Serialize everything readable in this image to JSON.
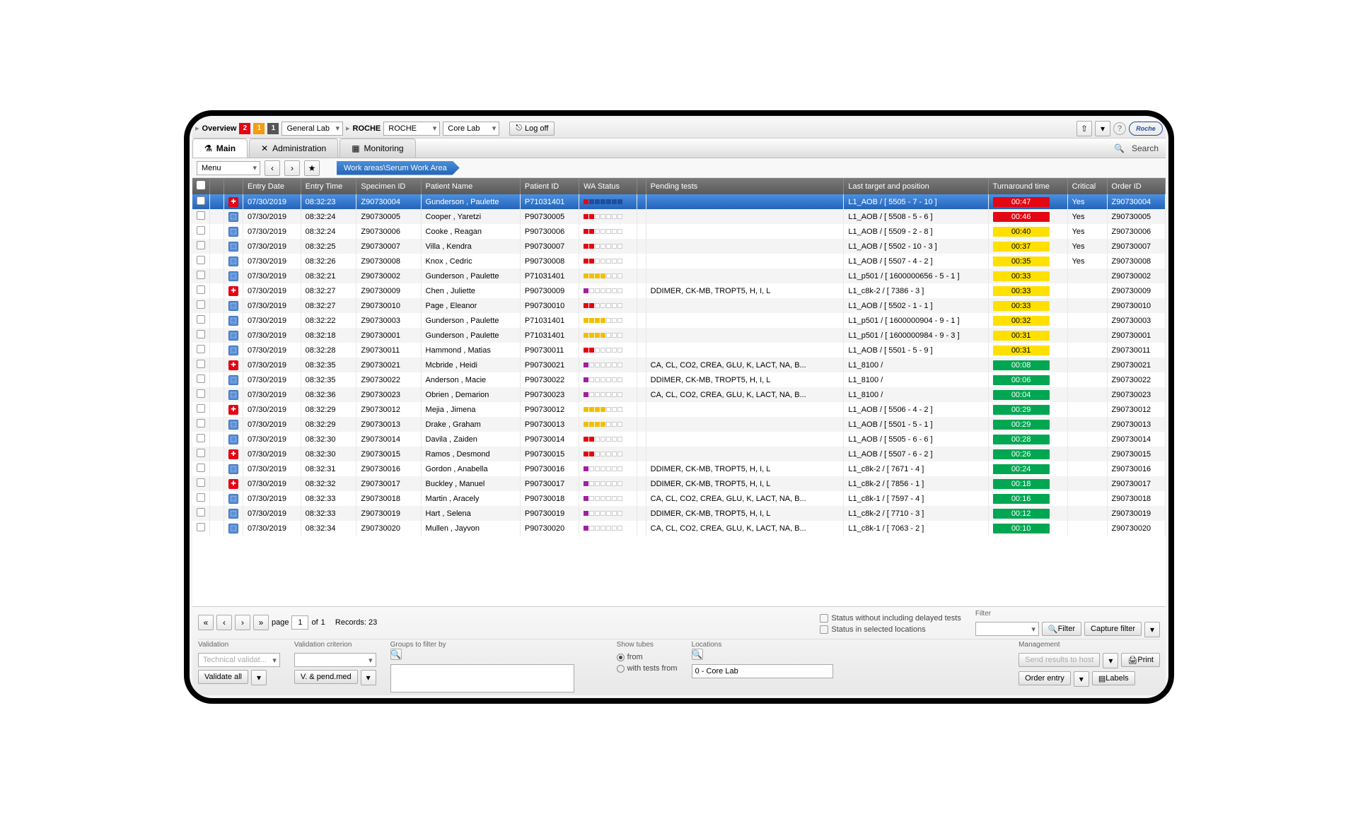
{
  "top": {
    "overview": "Overview",
    "badges": [
      "2",
      "1",
      "1"
    ],
    "lab_sel": "General Lab",
    "nav_arrow": "▸",
    "roche_label": "ROCHE",
    "roche_sel": "ROCHE",
    "corelab_sel": "Core Lab",
    "logoff": "Log off",
    "logo_text": "Roche"
  },
  "tabs": {
    "main": "Main",
    "admin": "Administration",
    "monitoring": "Monitoring",
    "search": "Search"
  },
  "toolbar": {
    "menu": "Menu",
    "prev": "‹",
    "next": "›",
    "star": "★",
    "breadcrumb": "Work areas\\Serum Work Area"
  },
  "cols": {
    "c0": "",
    "c1": "",
    "c2": "",
    "entry_date": "Entry Date",
    "entry_time": "Entry Time",
    "specimen": "Specimen ID",
    "patient": "Patient Name",
    "patient_id": "Patient ID",
    "wa": "WA Status",
    "pending": "Pending tests",
    "target": "Last target and position",
    "tat": "Turnaround time",
    "critical": "Critical",
    "order": "Order ID"
  },
  "rows": [
    {
      "sel": true,
      "icon": "red",
      "date": "07/30/2019",
      "time": "08:32:23",
      "spec": "Z90730004",
      "pat": "Gunderson , Paulette",
      "pid": "P71031401",
      "wa": "rbbbbbb",
      "pend": "",
      "tgt": "L1_AOB / [ 5505 - 7 - 10 ]",
      "tat": "00:47",
      "tcolor": "red",
      "crit": "Yes",
      "ord": "Z90730004"
    },
    {
      "icon": "blue",
      "date": "07/30/2019",
      "time": "08:32:24",
      "spec": "Z90730005",
      "pat": "Cooper , Yaretzi",
      "pid": "P90730005",
      "wa": "rr.....",
      "pend": "",
      "tgt": "L1_AOB / [ 5508 - 5 - 6 ]",
      "tat": "00:46",
      "tcolor": "red",
      "crit": "Yes",
      "ord": "Z90730005"
    },
    {
      "icon": "blue",
      "date": "07/30/2019",
      "time": "08:32:24",
      "spec": "Z90730006",
      "pat": "Cooke , Reagan",
      "pid": "P90730006",
      "wa": "rr.....",
      "pend": "",
      "tgt": "L1_AOB / [ 5509 - 2 - 8 ]",
      "tat": "00:40",
      "tcolor": "yellow",
      "crit": "Yes",
      "ord": "Z90730006"
    },
    {
      "icon": "blue",
      "date": "07/30/2019",
      "time": "08:32:25",
      "spec": "Z90730007",
      "pat": "Villa , Kendra",
      "pid": "P90730007",
      "wa": "rr.....",
      "pend": "",
      "tgt": "L1_AOB / [ 5502 - 10 - 3 ]",
      "tat": "00:37",
      "tcolor": "yellow",
      "crit": "Yes",
      "ord": "Z90730007"
    },
    {
      "icon": "blue",
      "date": "07/30/2019",
      "time": "08:32:26",
      "spec": "Z90730008",
      "pat": "Knox , Cedric",
      "pid": "P90730008",
      "wa": "rr.....",
      "pend": "",
      "tgt": "L1_AOB / [ 5507 - 4 - 2 ]",
      "tat": "00:35",
      "tcolor": "yellow",
      "crit": "Yes",
      "ord": "Z90730008"
    },
    {
      "icon": "blue",
      "date": "07/30/2019",
      "time": "08:32:21",
      "spec": "Z90730002",
      "pat": "Gunderson , Paulette",
      "pid": "P71031401",
      "wa": "yyyy...",
      "pend": "",
      "tgt": "L1_p501 / [ 1600000656 - 5 - 1 ]",
      "tat": "00:33",
      "tcolor": "yellow",
      "crit": "",
      "ord": "Z90730002"
    },
    {
      "icon": "red",
      "date": "07/30/2019",
      "time": "08:32:27",
      "spec": "Z90730009",
      "pat": "Chen , Juliette",
      "pid": "P90730009",
      "wa": "m......",
      "pend": "DDIMER, CK-MB, TROPT5, H, I, L",
      "tgt": "L1_c8k-2 / [ 7386 - 3 ]",
      "tat": "00:33",
      "tcolor": "yellow",
      "crit": "",
      "ord": "Z90730009"
    },
    {
      "icon": "blue",
      "date": "07/30/2019",
      "time": "08:32:27",
      "spec": "Z90730010",
      "pat": "Page , Eleanor",
      "pid": "P90730010",
      "wa": "rr.....",
      "pend": "",
      "tgt": "L1_AOB / [ 5502 - 1 - 1 ]",
      "tat": "00:33",
      "tcolor": "yellow",
      "crit": "",
      "ord": "Z90730010"
    },
    {
      "icon": "blue",
      "date": "07/30/2019",
      "time": "08:32:22",
      "spec": "Z90730003",
      "pat": "Gunderson , Paulette",
      "pid": "P71031401",
      "wa": "yyyy...",
      "pend": "",
      "tgt": "L1_p501 / [ 1600000904 - 9 - 1 ]",
      "tat": "00:32",
      "tcolor": "yellow",
      "crit": "",
      "ord": "Z90730003"
    },
    {
      "icon": "blue",
      "date": "07/30/2019",
      "time": "08:32:18",
      "spec": "Z90730001",
      "pat": "Gunderson , Paulette",
      "pid": "P71031401",
      "wa": "yyyy...",
      "pend": "",
      "tgt": "L1_p501 / [ 1600000984 - 9 - 3 ]",
      "tat": "00:31",
      "tcolor": "yellow",
      "crit": "",
      "ord": "Z90730001"
    },
    {
      "icon": "blue",
      "date": "07/30/2019",
      "time": "08:32:28",
      "spec": "Z90730011",
      "pat": "Hammond , Matias",
      "pid": "P90730011",
      "wa": "rr.....",
      "pend": "",
      "tgt": "L1_AOB / [ 5501 - 5 - 9 ]",
      "tat": "00:31",
      "tcolor": "yellow",
      "crit": "",
      "ord": "Z90730011"
    },
    {
      "icon": "red",
      "date": "07/30/2019",
      "time": "08:32:35",
      "spec": "Z90730021",
      "pat": "Mcbride , Heidi",
      "pid": "P90730021",
      "wa": "m......",
      "pend": "CA, CL, CO2, CREA, GLU, K, LACT, NA, B...",
      "tgt": "L1_8100 /",
      "tat": "00:08",
      "tcolor": "green",
      "crit": "",
      "ord": "Z90730021"
    },
    {
      "icon": "blue",
      "date": "07/30/2019",
      "time": "08:32:35",
      "spec": "Z90730022",
      "pat": "Anderson , Macie",
      "pid": "P90730022",
      "wa": "m......",
      "pend": "DDIMER, CK-MB, TROPT5, H, I, L",
      "tgt": "L1_8100 /",
      "tat": "00:06",
      "tcolor": "green",
      "crit": "",
      "ord": "Z90730022"
    },
    {
      "icon": "blue",
      "date": "07/30/2019",
      "time": "08:32:36",
      "spec": "Z90730023",
      "pat": "Obrien , Demarion",
      "pid": "P90730023",
      "wa": "m......",
      "pend": "CA, CL, CO2, CREA, GLU, K, LACT, NA, B...",
      "tgt": "L1_8100 /",
      "tat": "00:04",
      "tcolor": "green",
      "crit": "",
      "ord": "Z90730023"
    },
    {
      "icon": "red",
      "date": "07/30/2019",
      "time": "08:32:29",
      "spec": "Z90730012",
      "pat": "Mejia , Jimena",
      "pid": "P90730012",
      "wa": "yyyy...",
      "pend": "",
      "tgt": "L1_AOB / [ 5506 - 4 - 2 ]",
      "tat": "00:29",
      "tcolor": "green",
      "crit": "",
      "ord": "Z90730012"
    },
    {
      "icon": "blue",
      "date": "07/30/2019",
      "time": "08:32:29",
      "spec": "Z90730013",
      "pat": "Drake , Graham",
      "pid": "P90730013",
      "wa": "yyyy...",
      "pend": "",
      "tgt": "L1_AOB / [ 5501 - 5 - 1 ]",
      "tat": "00:29",
      "tcolor": "green",
      "crit": "",
      "ord": "Z90730013"
    },
    {
      "icon": "blue",
      "date": "07/30/2019",
      "time": "08:32:30",
      "spec": "Z90730014",
      "pat": "Davila , Zaiden",
      "pid": "P90730014",
      "wa": "rr.....",
      "pend": "",
      "tgt": "L1_AOB / [ 5505 - 6 - 6 ]",
      "tat": "00:28",
      "tcolor": "green",
      "crit": "",
      "ord": "Z90730014"
    },
    {
      "icon": "red",
      "date": "07/30/2019",
      "time": "08:32:30",
      "spec": "Z90730015",
      "pat": "Ramos , Desmond",
      "pid": "P90730015",
      "wa": "rr.....",
      "pend": "",
      "tgt": "L1_AOB / [ 5507 - 6 - 2 ]",
      "tat": "00:26",
      "tcolor": "green",
      "crit": "",
      "ord": "Z90730015"
    },
    {
      "icon": "blue",
      "date": "07/30/2019",
      "time": "08:32:31",
      "spec": "Z90730016",
      "pat": "Gordon , Anabella",
      "pid": "P90730016",
      "wa": "m......",
      "pend": "DDIMER, CK-MB, TROPT5, H, I, L",
      "tgt": "L1_c8k-2 / [ 7671 - 4 ]",
      "tat": "00:24",
      "tcolor": "green",
      "crit": "",
      "ord": "Z90730016"
    },
    {
      "icon": "red",
      "date": "07/30/2019",
      "time": "08:32:32",
      "spec": "Z90730017",
      "pat": "Buckley , Manuel",
      "pid": "P90730017",
      "wa": "m......",
      "pend": "DDIMER, CK-MB, TROPT5, H, I, L",
      "tgt": "L1_c8k-2 / [ 7856 - 1 ]",
      "tat": "00:18",
      "tcolor": "green",
      "crit": "",
      "ord": "Z90730017"
    },
    {
      "icon": "blue",
      "date": "07/30/2019",
      "time": "08:32:33",
      "spec": "Z90730018",
      "pat": "Martin , Aracely",
      "pid": "P90730018",
      "wa": "m......",
      "pend": "CA, CL, CO2, CREA, GLU, K, LACT, NA, B...",
      "tgt": "L1_c8k-1 / [ 7597 - 4 ]",
      "tat": "00:16",
      "tcolor": "green",
      "crit": "",
      "ord": "Z90730018"
    },
    {
      "icon": "blue",
      "date": "07/30/2019",
      "time": "08:32:33",
      "spec": "Z90730019",
      "pat": "Hart , Selena",
      "pid": "P90730019",
      "wa": "m......",
      "pend": "DDIMER, CK-MB, TROPT5, H, I, L",
      "tgt": "L1_c8k-2 / [ 7710 - 3 ]",
      "tat": "00:12",
      "tcolor": "green",
      "crit": "",
      "ord": "Z90730019"
    },
    {
      "icon": "blue",
      "date": "07/30/2019",
      "time": "08:32:34",
      "spec": "Z90730020",
      "pat": "Mullen , Jayvon",
      "pid": "P90730020",
      "wa": "m......",
      "pend": "CA, CL, CO2, CREA, GLU, K, LACT, NA, B...",
      "tgt": "L1_c8k-1 / [ 7063 - 2 ]",
      "tat": "00:10",
      "tcolor": "green",
      "crit": "",
      "ord": "Z90730020"
    }
  ],
  "footer": {
    "page_lbl": "page",
    "page_cur": "1",
    "of": "of",
    "page_tot": "1",
    "records": "Records: 23",
    "validation": "Validation",
    "show_tubes": "Show tubes",
    "filter": "Filter",
    "management": "Management",
    "tech_val": "Technical validat...",
    "val_crit": "Validation criterion",
    "groups": "Groups to filter by",
    "validate_all": "Validate all",
    "v_pend": "V. & pend.med",
    "from": "from",
    "with_tests": "with tests from",
    "locations": "Locations",
    "loc_val": "0 - Core Lab",
    "status1": "Status without including delayed tests",
    "status2": "Status in selected locations",
    "filter_btn": "Filter",
    "capture": "Capture filter",
    "send_results": "Send results to host",
    "print": "Print",
    "order_entry": "Order entry",
    "labels": "Labels"
  }
}
